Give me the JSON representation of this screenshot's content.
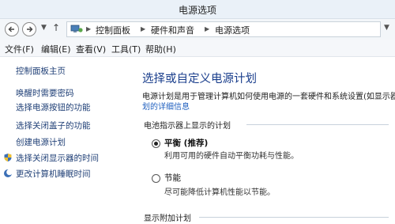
{
  "window": {
    "title": "电源选项"
  },
  "nav": {
    "breadcrumbs": [
      "控制面板",
      "硬件和声音",
      "电源选项"
    ]
  },
  "menu": [
    "文件(F)",
    "编辑(E)",
    "查看(V)",
    "工具(T)",
    "帮助(H)"
  ],
  "sidebar": {
    "items": [
      {
        "label": "控制面板主页"
      },
      {
        "label": "唤醒时需要密码"
      },
      {
        "label": "选择电源按钮的功能"
      },
      {
        "label": "选择关闭盖子的功能"
      },
      {
        "label": "创建电源计划"
      },
      {
        "label": "选择关闭显示器的时间",
        "icon": "shield-icon"
      },
      {
        "label": "更改计算机睡眠时间",
        "icon": "moon-icon"
      }
    ]
  },
  "main": {
    "heading": "选择或自定义电源计划",
    "description": "电源计划是用于管理计算机如何使用电源的一套硬件和系统设置(如显示器",
    "description_link": "划的详细信息",
    "battery_section": "电池指示器上显示的计划",
    "plans": [
      {
        "name": "平衡 (推荐)",
        "desc": "利用可用的硬件自动平衡功耗与性能。",
        "selected": true
      },
      {
        "name": "节能",
        "desc": "尽可能降低计算机性能以节能。",
        "selected": false
      }
    ],
    "additional_section": "显示附加计划"
  }
}
